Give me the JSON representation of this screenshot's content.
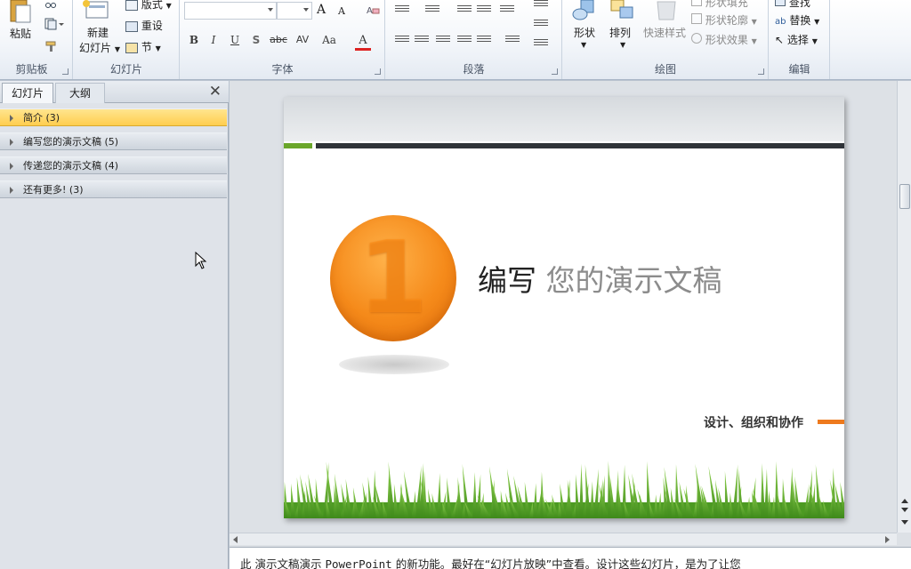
{
  "ribbon": {
    "clipboard": {
      "label": "剪贴板",
      "paste": "粘贴"
    },
    "slides": {
      "label": "幻灯片",
      "new_slide_line1": "新建",
      "new_slide_line2": "幻灯片",
      "layout": "版式",
      "reset": "重设",
      "section": "节"
    },
    "font": {
      "label": "字体",
      "bold": "B",
      "italic": "I",
      "underline": "U",
      "shadow": "S",
      "strike": "abc",
      "spacing": "AV",
      "case": "Aa",
      "color": "A",
      "grow": "A",
      "shrink": "A"
    },
    "paragraph": {
      "label": "段落"
    },
    "drawing": {
      "label": "绘图",
      "shapes": "形状",
      "arrange": "排列",
      "quick_styles": "快速样式",
      "shape_fill": "形状填充",
      "shape_outline": "形状轮廓",
      "shape_effects": "形状效果"
    },
    "editing": {
      "label": "编辑",
      "find": "查找",
      "replace": "替换",
      "select": "选择"
    }
  },
  "left_panel": {
    "tab_slides": "幻灯片",
    "tab_outline": "大纲",
    "close": "✕",
    "sections": [
      {
        "label": "简介 (3)",
        "selected": true
      },
      {
        "label": "编写您的演示文稿 (5)",
        "selected": false
      },
      {
        "label": "传递您的演示文稿 (4)",
        "selected": false
      },
      {
        "label": "还有更多! (3)",
        "selected": false
      }
    ]
  },
  "slide": {
    "number": "1",
    "title_strong": "编写",
    "title_light": "您的演示文稿",
    "subtitle": "设计、组织和协作",
    "colors": {
      "accent_orange": "#ee7a1d",
      "accent_green": "#6aa62a",
      "dark_rule": "#2f3338"
    }
  },
  "notes": {
    "prefix": "此 演示文稿演示 ",
    "app_name": "PowerPoint",
    "suffix": " 的新功能。最好在“幻灯片放映”中查看。设计这些幻灯片，是为了让您"
  }
}
